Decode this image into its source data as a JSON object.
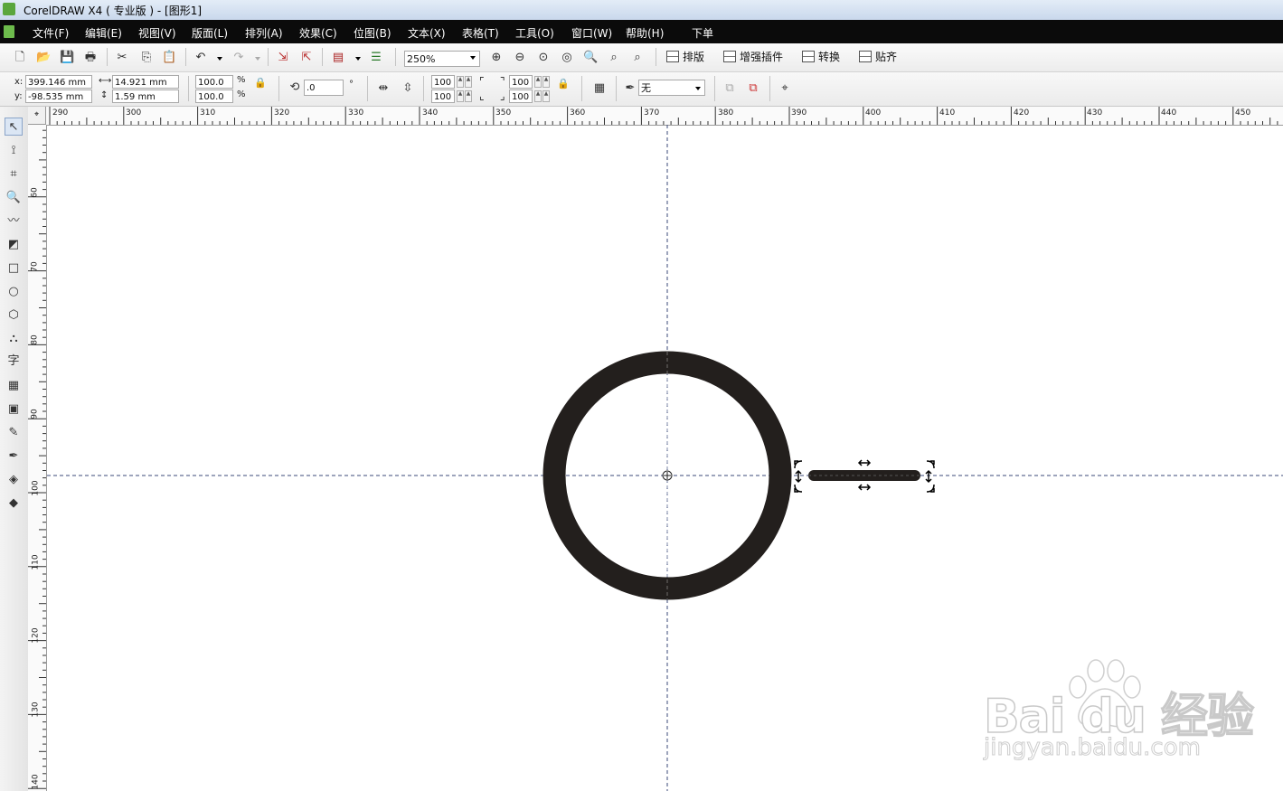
{
  "window": {
    "title": "CorelDRAW X4 ( 专业版 ) - [图形1]"
  },
  "menu": [
    "文件(F)",
    "编辑(E)",
    "视图(V)",
    "版面(L)",
    "排列(A)",
    "效果(C)",
    "位图(B)",
    "文本(X)",
    "表格(T)",
    "工具(O)",
    "窗口(W)",
    "帮助(H)",
    "下单"
  ],
  "standard_toolbar": {
    "zoom_value": "250%",
    "buttons": [
      "排版",
      "增强插件",
      "转换",
      "贴齐"
    ]
  },
  "property_bar": {
    "x_label": "x:",
    "x_value": "399.146 mm",
    "y_label": "y:",
    "y_value": "-98.535 mm",
    "width_value": "14.921 mm",
    "height_value": "1.59 mm",
    "scale_w": "100.0",
    "scale_h": "100.0",
    "percent": "%",
    "rotation_value": ".0",
    "degree": "°",
    "stretch1_top": "100",
    "stretch1_bottom": "100",
    "stretch2_top": "100",
    "stretch2_bottom": "100",
    "outline_value": "无"
  },
  "rulers": {
    "horizontal": [
      "290",
      "300",
      "310",
      "320",
      "330",
      "340",
      "350",
      "360",
      "370",
      "380",
      "390",
      "400",
      "410",
      "420",
      "430",
      "440",
      "450"
    ],
    "vertical": [
      "60",
      "70",
      "80",
      "90",
      "100",
      "110",
      "120",
      "130",
      "140"
    ]
  },
  "watermark": {
    "brand": "Bai du 经验",
    "url": "jingyan.baidu.com"
  },
  "colors": {
    "shape_fill": "#231f1d",
    "guide_color": "#3b4a7a",
    "menubar_bg": "#0b0b0b"
  }
}
